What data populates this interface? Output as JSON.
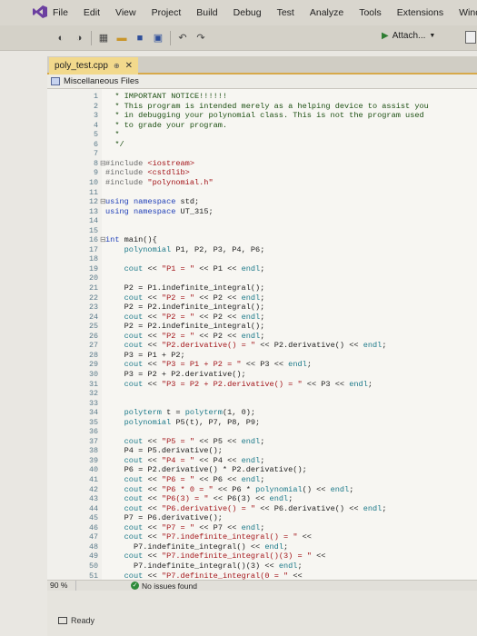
{
  "menu": {
    "items": [
      "File",
      "Edit",
      "View",
      "Project",
      "Build",
      "Debug",
      "Test",
      "Analyze",
      "Tools",
      "Extensions",
      "Windo"
    ]
  },
  "toolbar": {
    "attach_label": "Attach...",
    "icons": [
      "back-icon",
      "forward-icon",
      "new-project-icon",
      "open-icon",
      "save-icon",
      "save-all-icon",
      "undo-icon",
      "redo-icon"
    ]
  },
  "tab": {
    "title": "poly_test.cpp",
    "pin_symbol": "⊕",
    "close_symbol": "✕"
  },
  "navbar": {
    "scope": "Miscellaneous Files"
  },
  "editor": {
    "lines": [
      {
        "n": "1",
        "t": "  * IMPORTANT NOTICE!!!!!!"
      },
      {
        "n": "2",
        "t": "  * This program is intended merely as a helping device to assist you"
      },
      {
        "n": "3",
        "t": "  * in debugging your polynomial class. This is not the program used"
      },
      {
        "n": "4",
        "t": "  * to grade your program."
      },
      {
        "n": "5",
        "t": "  *"
      },
      {
        "n": "6",
        "t": "  */"
      },
      {
        "n": "7",
        "t": ""
      },
      {
        "n": "8",
        "t": "#include <iostream>"
      },
      {
        "n": "9",
        "t": "#include <cstdlib>"
      },
      {
        "n": "10",
        "t": "#include \"polynomial.h\""
      },
      {
        "n": "11",
        "t": ""
      },
      {
        "n": "12",
        "t": "using namespace std;"
      },
      {
        "n": "13",
        "t": "using namespace UT_315;"
      },
      {
        "n": "14",
        "t": ""
      },
      {
        "n": "15",
        "t": ""
      },
      {
        "n": "16",
        "t": "int main(){"
      },
      {
        "n": "17",
        "t": "    polynomial P1, P2, P3, P4, P6;"
      },
      {
        "n": "18",
        "t": ""
      },
      {
        "n": "19",
        "t": "    cout << \"P1 = \" << P1 << endl;"
      },
      {
        "n": "20",
        "t": ""
      },
      {
        "n": "21",
        "t": "    P2 = P1.indefinite_integral();"
      },
      {
        "n": "22",
        "t": "    cout << \"P2 = \" << P2 << endl;"
      },
      {
        "n": "23",
        "t": "    P2 = P2.indefinite_integral();"
      },
      {
        "n": "24",
        "t": "    cout << \"P2 = \" << P2 << endl;"
      },
      {
        "n": "25",
        "t": "    P2 = P2.indefinite_integral();"
      },
      {
        "n": "26",
        "t": "    cout << \"P2 = \" << P2 << endl;"
      },
      {
        "n": "27",
        "t": "    cout << \"P2.derivative() = \" << P2.derivative() << endl;"
      },
      {
        "n": "28",
        "t": "    P3 = P1 + P2;"
      },
      {
        "n": "29",
        "t": "    cout << \"P3 = P1 + P2 = \" << P3 << endl;"
      },
      {
        "n": "30",
        "t": "    P3 = P2 + P2.derivative();"
      },
      {
        "n": "31",
        "t": "    cout << \"P3 = P2 + P2.derivative() = \" << P3 << endl;"
      },
      {
        "n": "32",
        "t": ""
      },
      {
        "n": "33",
        "t": ""
      },
      {
        "n": "34",
        "t": "    polyterm t = polyterm(1, 0);"
      },
      {
        "n": "35",
        "t": "    polynomial P5(t), P7, P8, P9;"
      },
      {
        "n": "36",
        "t": ""
      },
      {
        "n": "37",
        "t": "    cout << \"P5 = \" << P5 << endl;"
      },
      {
        "n": "38",
        "t": "    P4 = P5.derivative();"
      },
      {
        "n": "39",
        "t": "    cout << \"P4 = \" << P4 << endl;"
      },
      {
        "n": "40",
        "t": "    P6 = P2.derivative() * P2.derivative();"
      },
      {
        "n": "41",
        "t": "    cout << \"P6 = \" << P6 << endl;"
      },
      {
        "n": "42",
        "t": "    cout << \"P6 * 0 = \" << P6 * polynomial() << endl;"
      },
      {
        "n": "43",
        "t": "    cout << \"P6(3) = \" << P6(3) << endl;"
      },
      {
        "n": "44",
        "t": "    cout << \"P6.derivative() = \" << P6.derivative() << endl;"
      },
      {
        "n": "45",
        "t": "    P7 = P6.derivative();"
      },
      {
        "n": "46",
        "t": "    cout << \"P7 = \" << P7 << endl;"
      },
      {
        "n": "47",
        "t": "    cout << \"P7.indefinite_integral() = \" <<"
      },
      {
        "n": "48",
        "t": "      P7.indefinite_integral() << endl;"
      },
      {
        "n": "49",
        "t": "    cout << \"P7.indefinite_integral()(3) = \" <<"
      },
      {
        "n": "50",
        "t": "      P7.indefinite_integral()(3) << endl;"
      },
      {
        "n": "51",
        "t": "    cout << \"P7.definite_integral(0 = \" <<"
      }
    ]
  },
  "status": {
    "zoom": "90 %",
    "issues": "No issues found",
    "ready": "Ready"
  },
  "colors": {
    "accent_tab": "#f2d98c",
    "keyword": "#1f3fb8",
    "string": "#a3151a"
  }
}
